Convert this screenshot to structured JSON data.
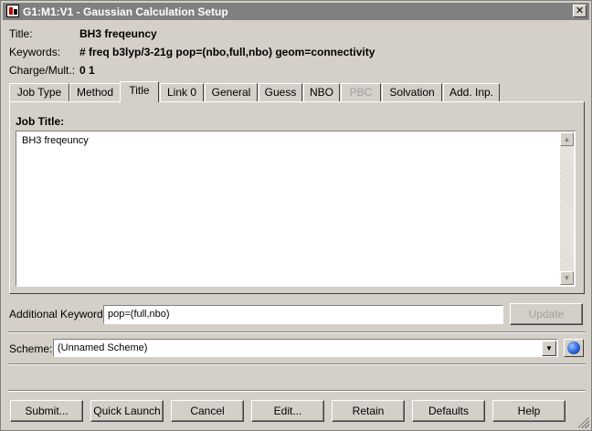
{
  "window": {
    "title": "G1:M1:V1 - Gaussian Calculation Setup"
  },
  "info": {
    "title_label": "Title:",
    "title_value": "BH3 freqeuncy",
    "keywords_label": "Keywords:",
    "keywords_value": "# freq b3lyp/3-21g pop=(nbo,full,nbo) geom=connectivity",
    "charge_label": "Charge/Mult.:",
    "charge_value": "0 1"
  },
  "tabs": [
    {
      "label": "Job Type",
      "active": false,
      "disabled": false
    },
    {
      "label": "Method",
      "active": false,
      "disabled": false
    },
    {
      "label": "Title",
      "active": true,
      "disabled": false
    },
    {
      "label": "Link 0",
      "active": false,
      "disabled": false
    },
    {
      "label": "General",
      "active": false,
      "disabled": false
    },
    {
      "label": "Guess",
      "active": false,
      "disabled": false
    },
    {
      "label": "NBO",
      "active": false,
      "disabled": false
    },
    {
      "label": "PBC",
      "active": false,
      "disabled": true
    },
    {
      "label": "Solvation",
      "active": false,
      "disabled": false
    },
    {
      "label": "Add. Inp.",
      "active": false,
      "disabled": false
    }
  ],
  "title_tab": {
    "job_title_label": "Job Title:",
    "job_title_value": "BH3 freqeuncy"
  },
  "additional": {
    "label": "Additional Keywords:",
    "value": "pop=(full,nbo)",
    "update_label": "Update"
  },
  "scheme": {
    "label": "Scheme:",
    "value": "(Unnamed Scheme)"
  },
  "buttons": {
    "submit": "Submit...",
    "quick_launch": "Quick Launch",
    "cancel": "Cancel",
    "edit": "Edit...",
    "retain": "Retain",
    "defaults": "Defaults",
    "help": "Help"
  },
  "icons": {
    "app": "gaussview-app-icon",
    "close": "close-icon",
    "scheme_manager": "globe-icon"
  }
}
